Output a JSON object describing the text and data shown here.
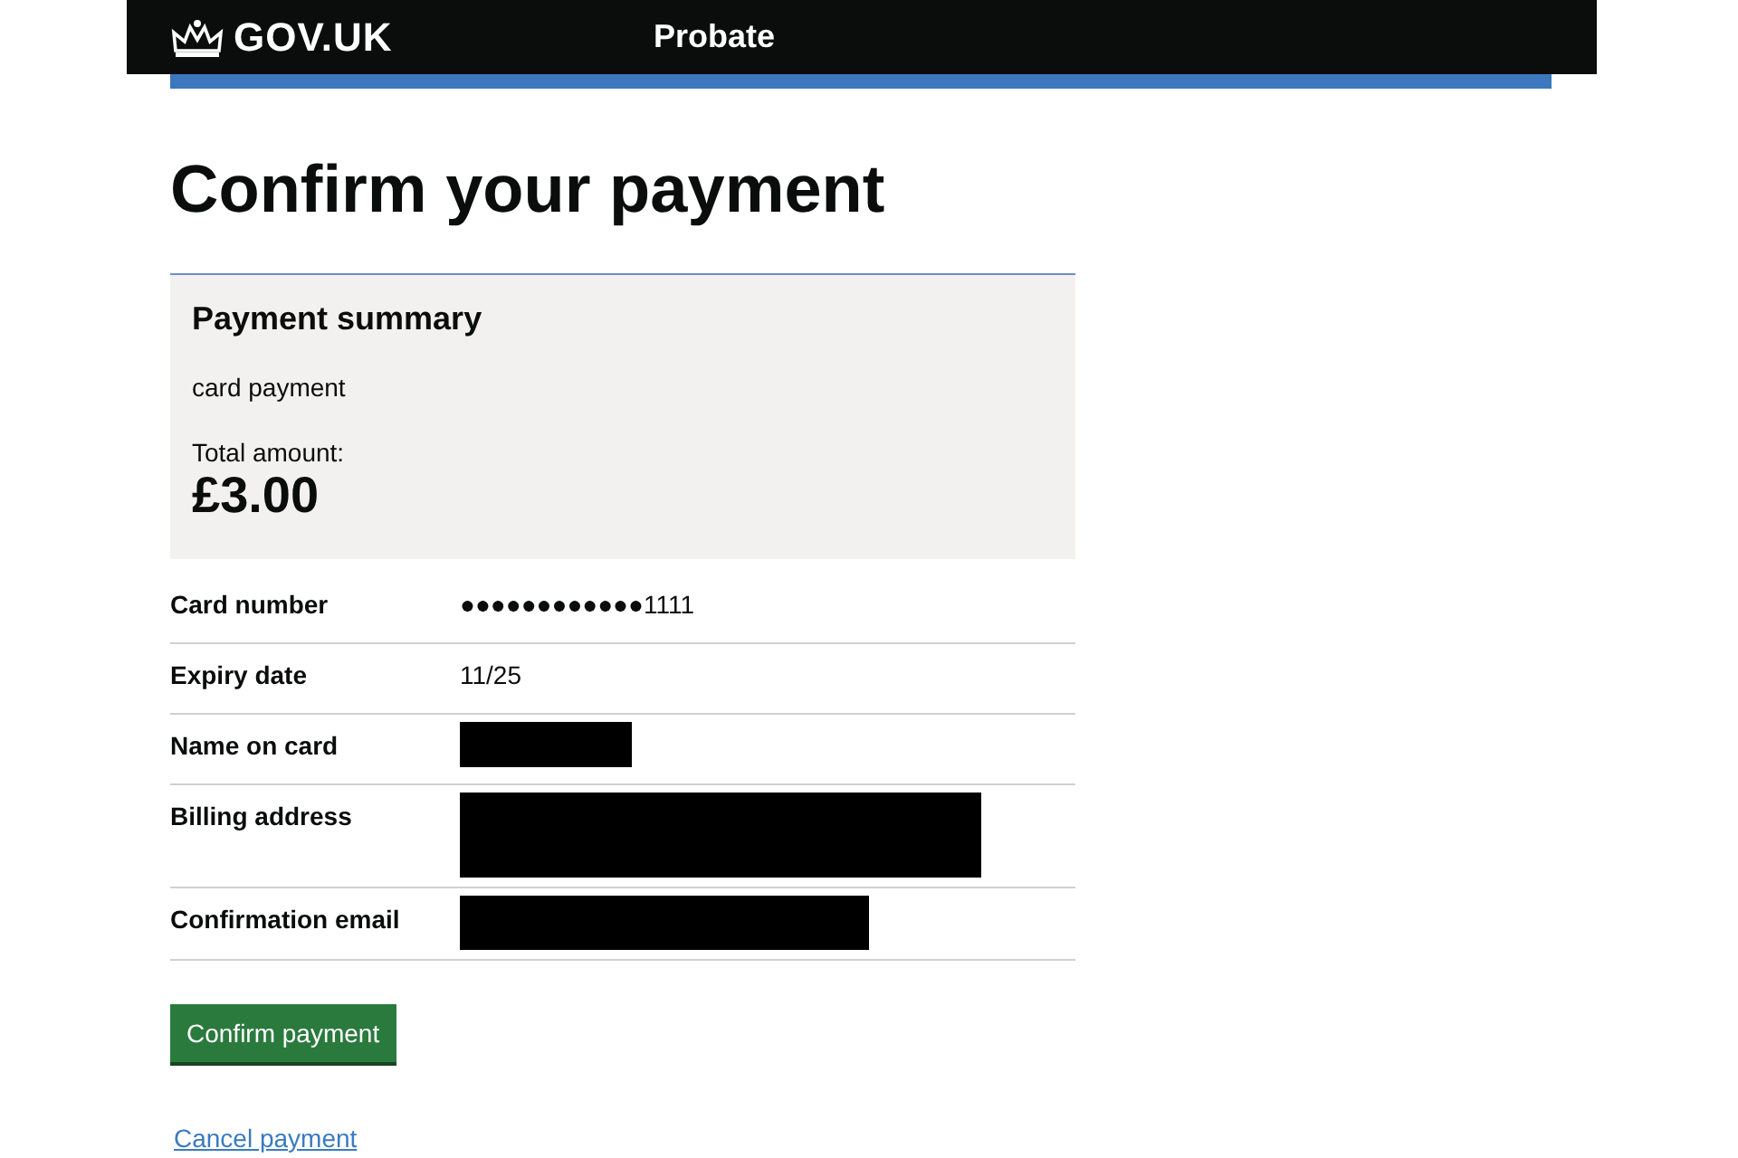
{
  "header": {
    "logo": "GOV.UK",
    "service": "Probate"
  },
  "heading": "Confirm your payment",
  "summary": {
    "title": "Payment summary",
    "description": "card payment",
    "total_label": "Total amount:",
    "total": "£3.00"
  },
  "details": [
    {
      "label": "Card number",
      "value": "●●●●●●●●●●●●1111",
      "redacted": false
    },
    {
      "label": "Expiry date",
      "value": "11/25",
      "redacted": false
    },
    {
      "label": "Name on card",
      "redacted": true
    },
    {
      "label": "Billing address",
      "redacted": true
    },
    {
      "label": "Confirmation email",
      "redacted": true
    }
  ],
  "confirm_button": "Confirm payment",
  "cancel_link": "Cancel payment"
}
